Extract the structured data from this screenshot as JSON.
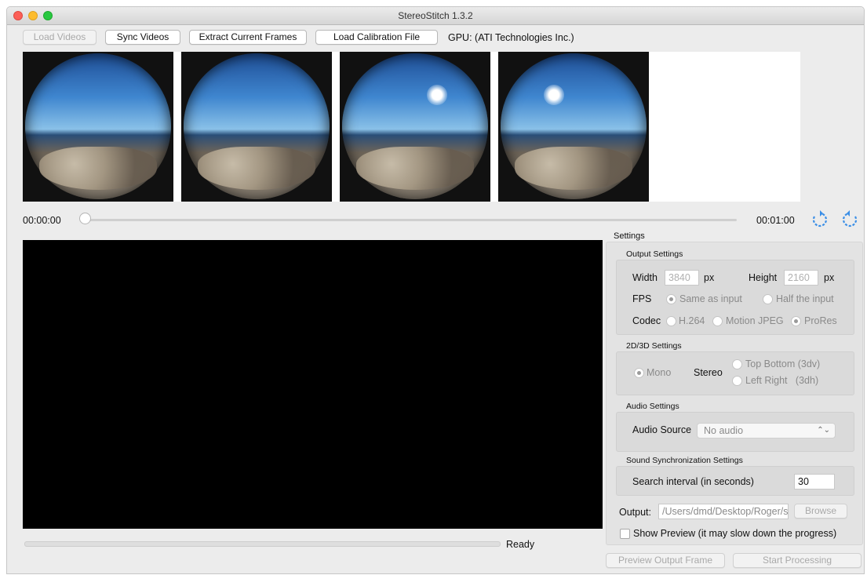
{
  "window": {
    "title": "StereoStitch 1.3.2"
  },
  "toolbar": {
    "load_videos": "Load Videos",
    "sync_videos": "Sync Videos",
    "extract_frames": "Extract Current Frames",
    "load_calibration": "Load Calibration File",
    "gpu_info": "GPU: (ATI Technologies Inc.)"
  },
  "timeline": {
    "start_time": "00:00:00",
    "end_time": "00:01:00",
    "position": 0
  },
  "status": {
    "text": "Ready"
  },
  "settings": {
    "title": "Settings",
    "output": {
      "title": "Output Settings",
      "width_label": "Width",
      "width_value": "3840",
      "width_unit": "px",
      "height_label": "Height",
      "height_value": "2160",
      "height_unit": "px",
      "fps_label": "FPS",
      "fps_same": "Same as input",
      "fps_half": "Half the input",
      "codec_label": "Codec",
      "codec_h264": "H.264",
      "codec_mjpeg": "Motion JPEG",
      "codec_prores": "ProRes"
    },
    "dimension": {
      "title": "2D/3D Settings",
      "mono": "Mono",
      "stereo_label": "Stereo",
      "top_bottom": "Top Bottom (3dv)",
      "left_right": "Left Right   (3dh)"
    },
    "audio": {
      "title": "Audio Settings",
      "source_label": "Audio Source",
      "source_value": "No audio"
    },
    "sound_sync": {
      "title": "Sound Synchronization Settings",
      "interval_label": "Search interval (in seconds)",
      "interval_value": "30"
    },
    "output_path": {
      "label": "Output:",
      "value": "/Users/dmd/Desktop/Roger/s",
      "browse": "Browse"
    },
    "show_preview": "Show Preview (it may slow down the progress)"
  },
  "actions": {
    "preview_frame": "Preview Output Frame",
    "start_processing": "Start Processing"
  },
  "icons": {
    "rotate_left": "rotate-ccw-icon",
    "rotate_right": "rotate-cw-icon",
    "accent": "#3a8ee6"
  }
}
